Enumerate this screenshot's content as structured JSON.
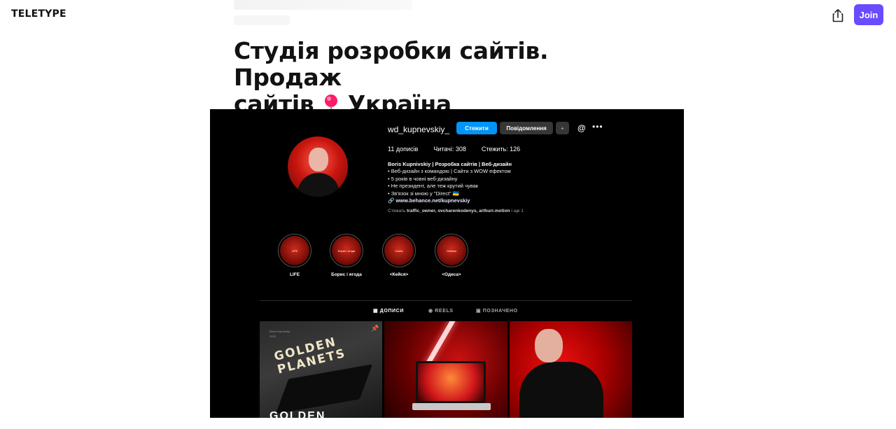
{
  "header": {
    "logo": "TELETYPE",
    "join_label": "Join"
  },
  "article": {
    "title_line1": "Студія розробки сайтів. Продаж",
    "title_line2_a": "сайтів",
    "title_line2_b": "Україна"
  },
  "embed": {
    "username": "wd_kupnevskiy_",
    "follow_label": "Стежити",
    "message_label": "Повідомлення",
    "stats": {
      "posts": "11 дописів",
      "followers": "Читачі: 308",
      "following": "Стежить: 126"
    },
    "bio": {
      "name": "Boris Kupnivskiy | Розробка сайтів | Веб-дизайн",
      "line1": "• Веб-дизайн з командою | Сайти з WOW ефектом",
      "line2": "• 5 років в човні веб-дизайну",
      "line3": "• Не президент, але теж крутий чувак",
      "line4": "• Зв'язок зі мною у \"Direct\" 🇺🇦",
      "link": "www.behance.net/kupnevskiy"
    },
    "followed_by_prefix": "Стежать",
    "followed_by_names": "traffic_owner, ovcharenkodenys, arthurr.motion",
    "followed_by_suffix": "і ще 1",
    "highlights": [
      {
        "label": "LIFE",
        "inner": "LIFE"
      },
      {
        "label": "Борис і ягода",
        "inner": "Борис і ягода"
      },
      {
        "label": "<Кейся>",
        "inner": "Cases"
      },
      {
        "label": "<Одеса>",
        "inner": "Odessa"
      }
    ],
    "tabs": {
      "posts": "ДОПИСИ",
      "reels": "REELS",
      "tagged": "ПОЗНАЧЕНО"
    },
    "post1": {
      "small_text": "Boris Kupnivskiy\n2023",
      "headline": "GOLDEN\nPLANETS",
      "bottom": "GOLDEN"
    }
  }
}
